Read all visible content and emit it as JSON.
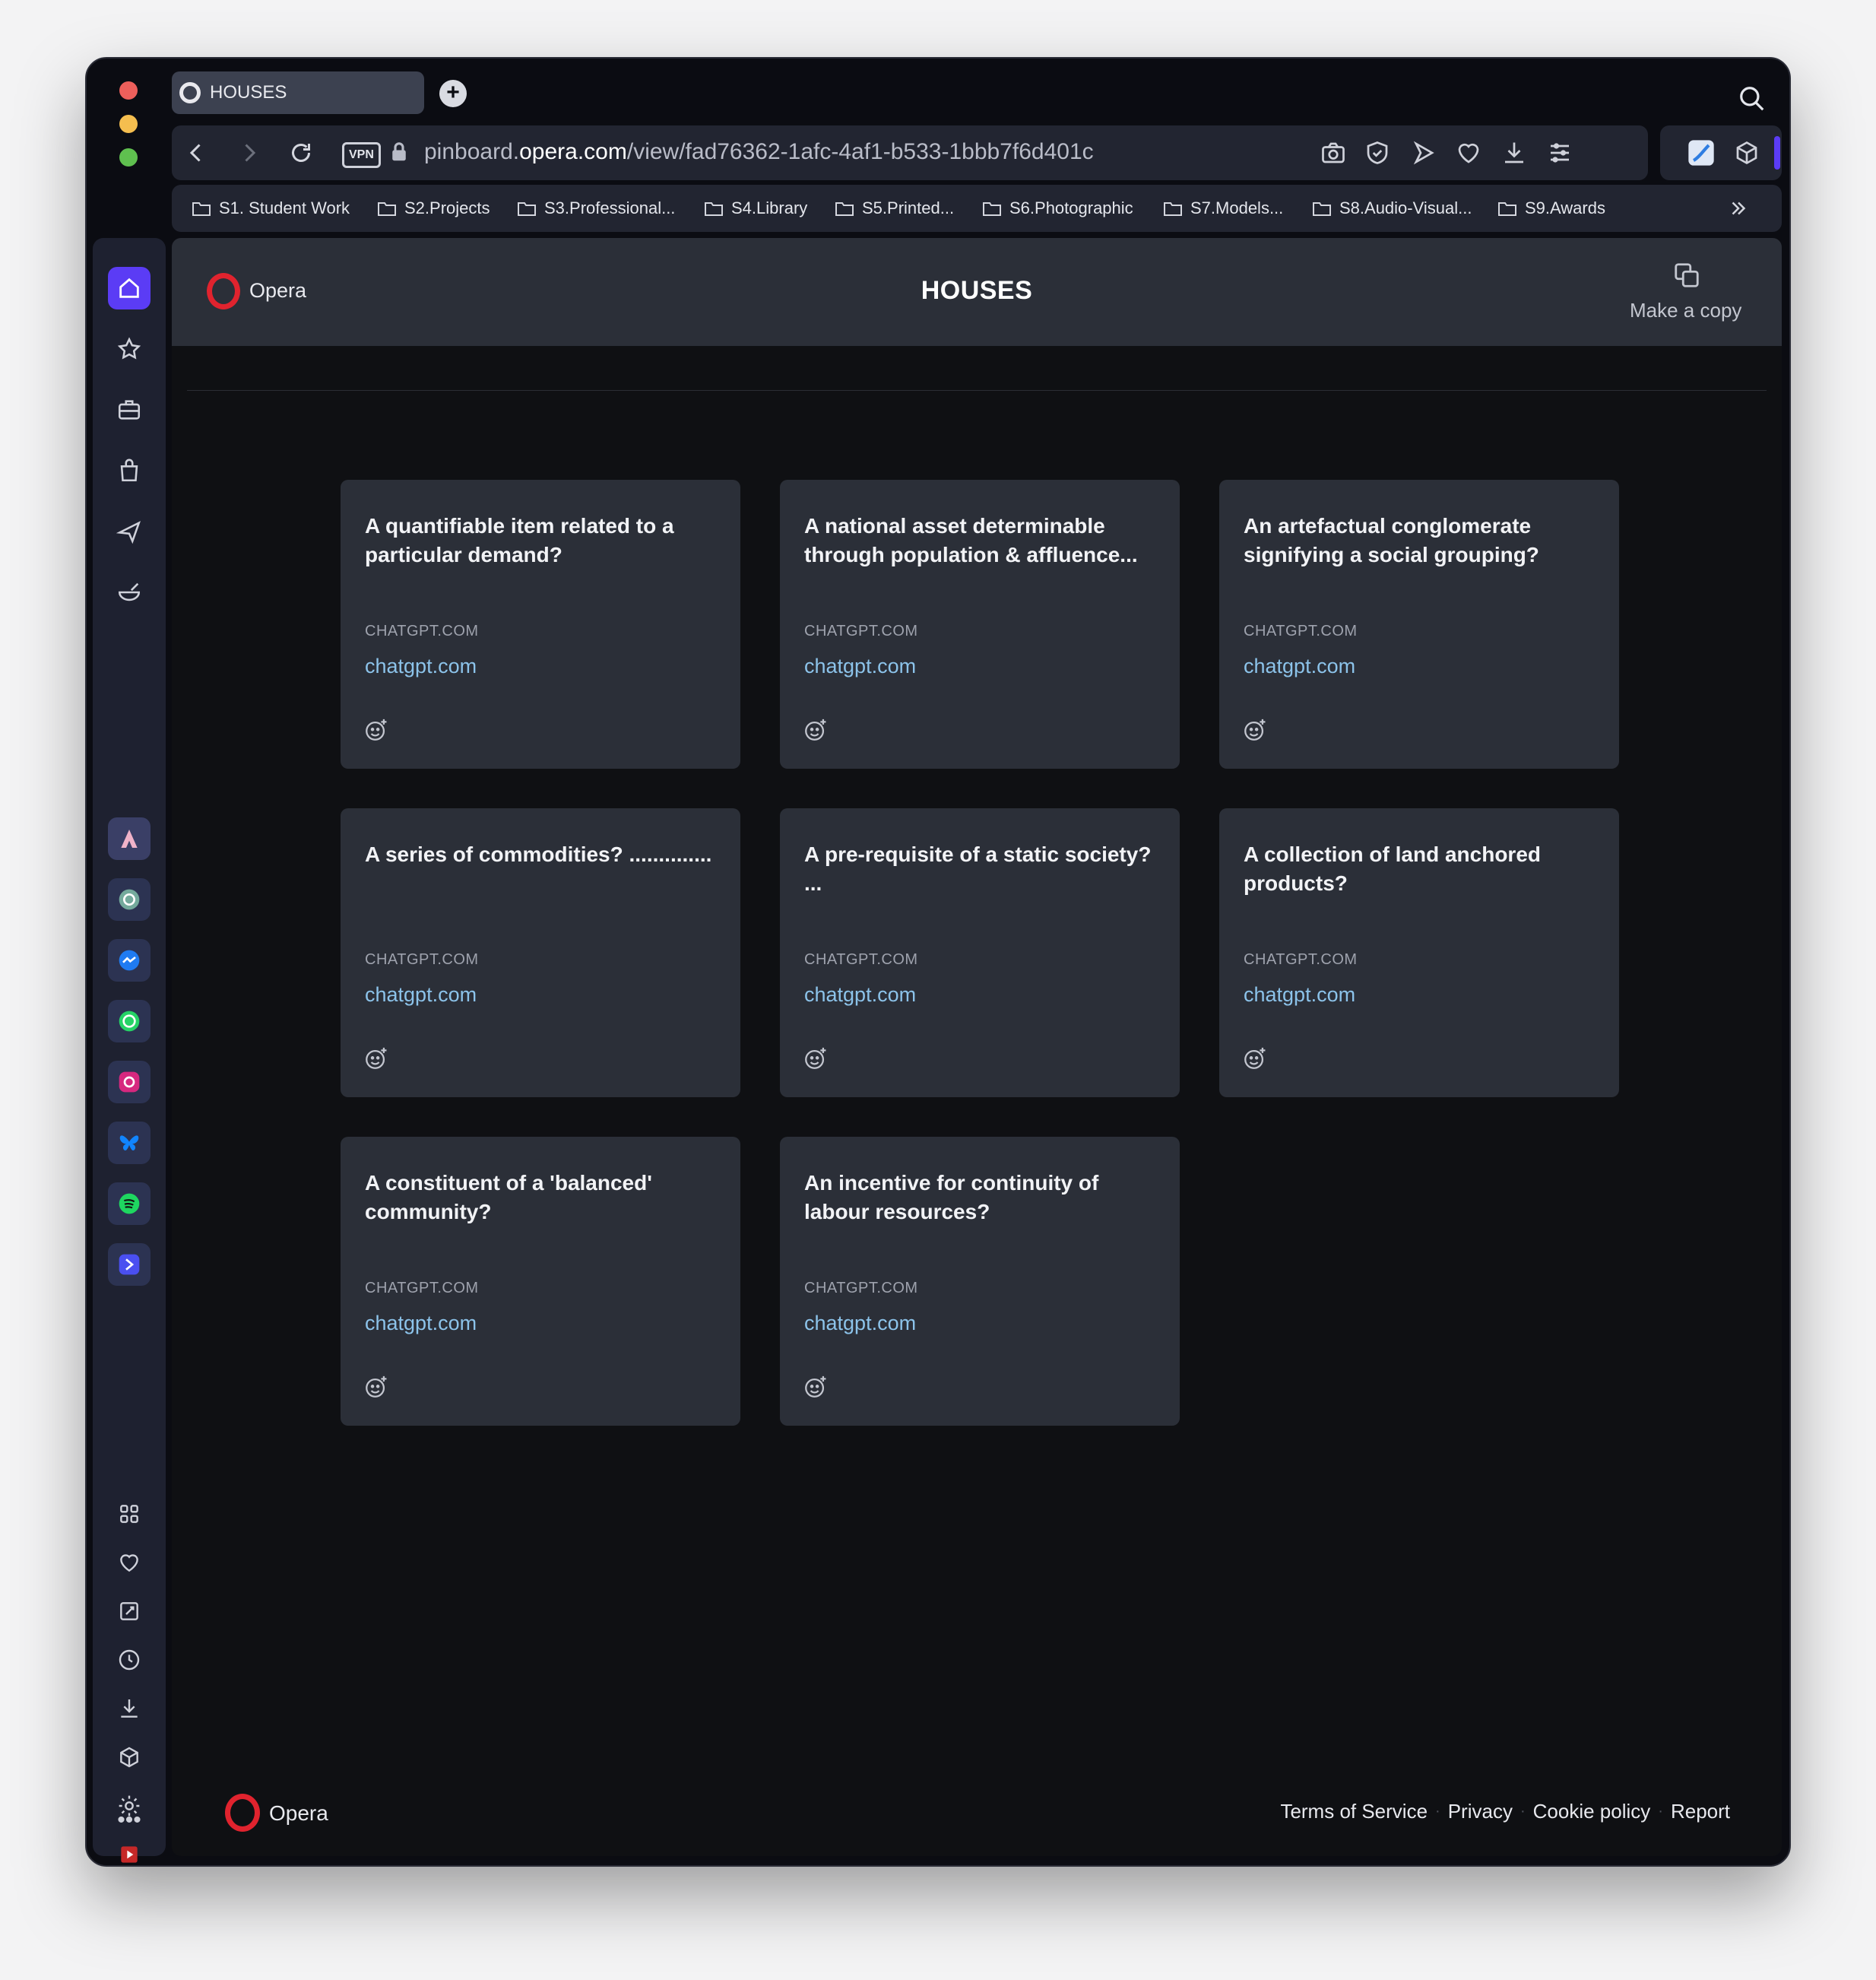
{
  "colors": {
    "close": "#ed5f5b",
    "minimize": "#f5be4f",
    "maximize": "#5fc04f",
    "accent": "#5b3cf5",
    "link": "#8cc3ea",
    "opera_red": "#e0232e"
  },
  "tab": {
    "title": "HOUSES",
    "icon": "opera-icon"
  },
  "address_bar": {
    "vpn_label": "VPN",
    "url_prefix": "pinboard.",
    "url_domain": "opera.com",
    "url_path": "/view/fad76362-1afc-4af1-b533-1bbb7f6d401c"
  },
  "bookmarks": [
    "S1. Student Work",
    "S2.Projects",
    "S3.Professional...",
    "S4.Library",
    "S5.Printed...",
    "S6.Photographic",
    "S7.Models...",
    "S8.Audio-Visual...",
    "S9.Awards"
  ],
  "page": {
    "brand": "Opera",
    "title": "HOUSES",
    "make_copy": "Make a copy"
  },
  "cards": [
    {
      "title": "A quantifiable item related to a particular demand?",
      "source": "CHATGPT.COM",
      "link": "chatgpt.com"
    },
    {
      "title": "A national asset determinable through population & affluence...",
      "source": "CHATGPT.COM",
      "link": "chatgpt.com"
    },
    {
      "title": "An artefactual conglomerate signifying a social grouping?",
      "source": "CHATGPT.COM",
      "link": "chatgpt.com"
    },
    {
      "title": "A series of commodities? ..............",
      "source": "CHATGPT.COM",
      "link": "chatgpt.com"
    },
    {
      "title": "A pre-requisite of a static society? ...",
      "source": "CHATGPT.COM",
      "link": "chatgpt.com"
    },
    {
      "title": "A collection of land anchored products?",
      "source": "CHATGPT.COM",
      "link": "chatgpt.com"
    },
    {
      "title": "A constituent of a 'balanced' community?",
      "source": "CHATGPT.COM",
      "link": "chatgpt.com"
    },
    {
      "title": "An incentive for continuity of labour resources?",
      "source": "CHATGPT.COM",
      "link": "chatgpt.com"
    }
  ],
  "footer": {
    "brand": "Opera",
    "links": [
      "Terms of Service",
      "Privacy",
      "Cookie policy",
      "Report"
    ]
  }
}
